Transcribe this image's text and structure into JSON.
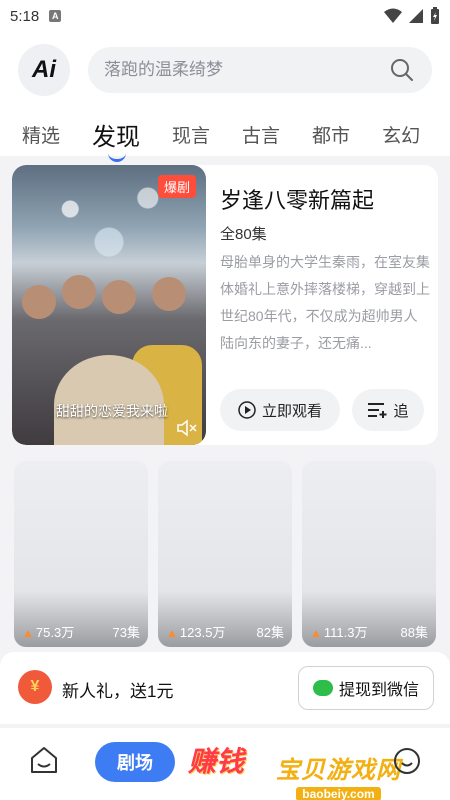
{
  "status_bar": {
    "time": "5:18",
    "notification_icon": "A"
  },
  "header": {
    "logo_text": "Ai",
    "search_placeholder": "落跑的温柔绮梦",
    "tabs": [
      "精选",
      "发现",
      "现言",
      "古言",
      "都市",
      "玄幻"
    ],
    "active_tab": "发现"
  },
  "featured": {
    "badge": "爆剧",
    "title": "岁逢八零新篇起",
    "episode_count": "全80集",
    "synopsis": "母胎单身的大学生秦雨，在室友集体婚礼上意外摔落楼梯，穿越到上世纪80年代，不仅成为超帅男人陆向东的妻子，还无痛...",
    "poster_caption": "甜甜的恋爱我来啦",
    "watch_label": "立即观看",
    "follow_label": "追"
  },
  "grid_items": [
    {
      "views": "75.3万",
      "episodes": "73集"
    },
    {
      "views": "123.5万",
      "episodes": "82集"
    },
    {
      "views": "111.3万",
      "episodes": "88集"
    }
  ],
  "bonus": {
    "text": "新人礼，送1元",
    "withdraw_label": "提现到微信"
  },
  "bottom_nav": {
    "theater_label": "剧场",
    "earn_label": "赚钱"
  },
  "watermark": {
    "main": "宝贝游戏网",
    "sub": "baobeiy.com"
  },
  "colors": {
    "accent_blue": "#3d7cf3",
    "badge_red": "#ff4d3c",
    "earn_red": "#ff3a4d",
    "wechat_green": "#2fbd4a"
  }
}
